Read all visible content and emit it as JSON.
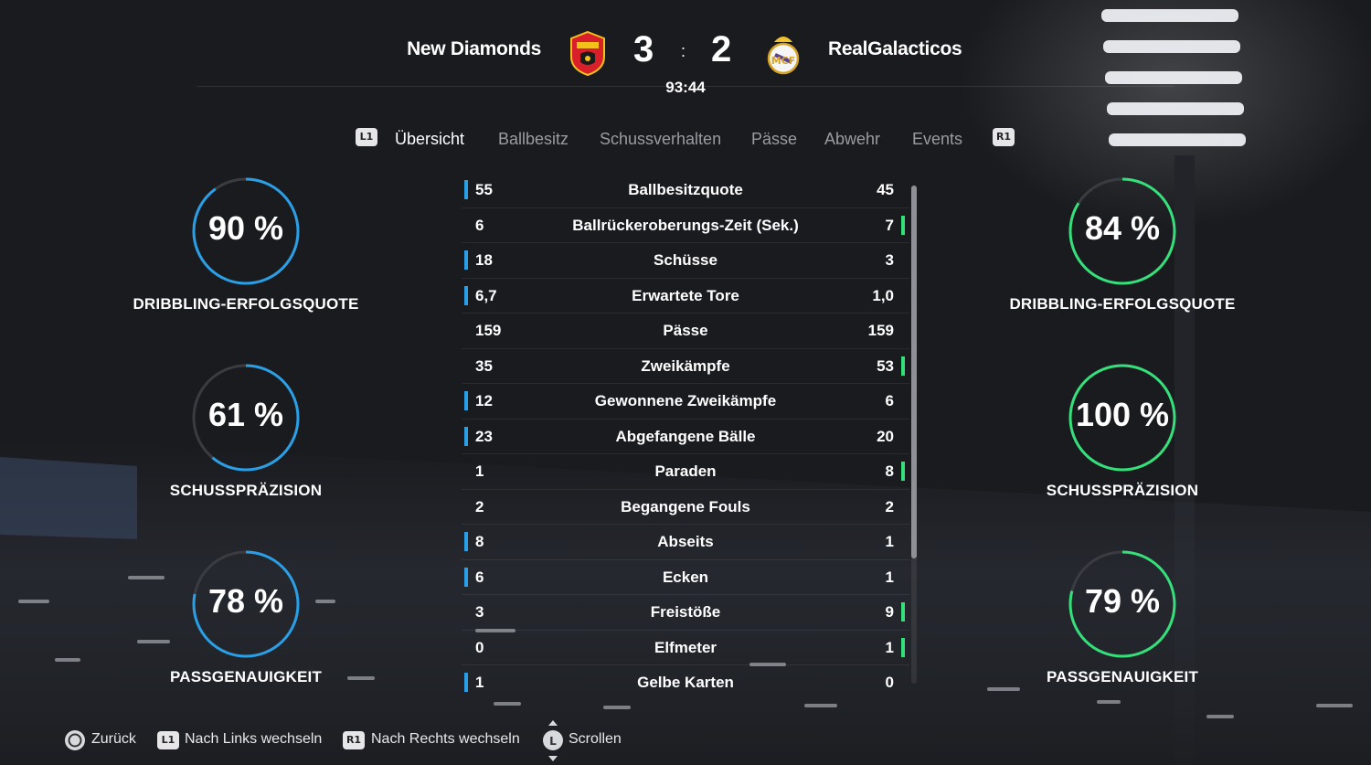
{
  "match": {
    "home_team": "New Diamonds",
    "away_team": "RealGalacticos",
    "home_score": "3",
    "away_score": "2",
    "separator": ":",
    "time": "93:44",
    "home_crest_icon": "manchester-united-crest-icon",
    "away_crest_icon": "real-madrid-crest-icon"
  },
  "tabs": {
    "left_shoulder": "L1",
    "right_shoulder": "R1",
    "items": [
      "Übersicht",
      "Ballbesitz",
      "Schussverhalten",
      "Pässe",
      "Abwehr",
      "Events"
    ],
    "active_index": 0
  },
  "colors": {
    "home": "#2a9fe6",
    "away": "#35e07a",
    "ring_track": "#3a3c42"
  },
  "home_circles": [
    {
      "value": "90 %",
      "percent": 90,
      "label": "DRIBBLING-ERFOLGSQUOTE"
    },
    {
      "value": "61 %",
      "percent": 61,
      "label": "SCHUSSPRÄZISION"
    },
    {
      "value": "78 %",
      "percent": 78,
      "label": "PASSGENAUIGKEIT"
    }
  ],
  "away_circles": [
    {
      "value": "84 %",
      "percent": 84,
      "label": "DRIBBLING-ERFOLGSQUOTE"
    },
    {
      "value": "100 %",
      "percent": 100,
      "label": "SCHUSSPRÄZISION"
    },
    {
      "value": "79 %",
      "percent": 79,
      "label": "PASSGENAUIGKEIT"
    }
  ],
  "stats": [
    {
      "home": "55",
      "name": "Ballbesitzquote",
      "away": "45",
      "leader": "home"
    },
    {
      "home": "6",
      "name": "Ballrückeroberungs-Zeit (Sek.)",
      "away": "7",
      "leader": "away"
    },
    {
      "home": "18",
      "name": "Schüsse",
      "away": "3",
      "leader": "home"
    },
    {
      "home": "6,7",
      "name": "Erwartete Tore",
      "away": "1,0",
      "leader": "home"
    },
    {
      "home": "159",
      "name": "Pässe",
      "away": "159",
      "leader": "none"
    },
    {
      "home": "35",
      "name": "Zweikämpfe",
      "away": "53",
      "leader": "away"
    },
    {
      "home": "12",
      "name": "Gewonnene Zweikämpfe",
      "away": "6",
      "leader": "home"
    },
    {
      "home": "23",
      "name": "Abgefangene Bälle",
      "away": "20",
      "leader": "home"
    },
    {
      "home": "1",
      "name": "Paraden",
      "away": "8",
      "leader": "away"
    },
    {
      "home": "2",
      "name": "Begangene Fouls",
      "away": "2",
      "leader": "none"
    },
    {
      "home": "8",
      "name": "Abseits",
      "away": "1",
      "leader": "home"
    },
    {
      "home": "6",
      "name": "Ecken",
      "away": "1",
      "leader": "home"
    },
    {
      "home": "3",
      "name": "Freistöße",
      "away": "9",
      "leader": "away"
    },
    {
      "home": "0",
      "name": "Elfmeter",
      "away": "1",
      "leader": "away"
    },
    {
      "home": "1",
      "name": "Gelbe Karten",
      "away": "0",
      "leader": "home"
    }
  ],
  "footer": {
    "back": {
      "glyph": "circle-button-icon",
      "label": "Zurück"
    },
    "left": {
      "glyph": "L1",
      "label": "Nach Links wechseln"
    },
    "right": {
      "glyph": "R1",
      "label": "Nach Rechts wechseln"
    },
    "scroll": {
      "glyph": "L",
      "label": "Scrollen"
    }
  }
}
